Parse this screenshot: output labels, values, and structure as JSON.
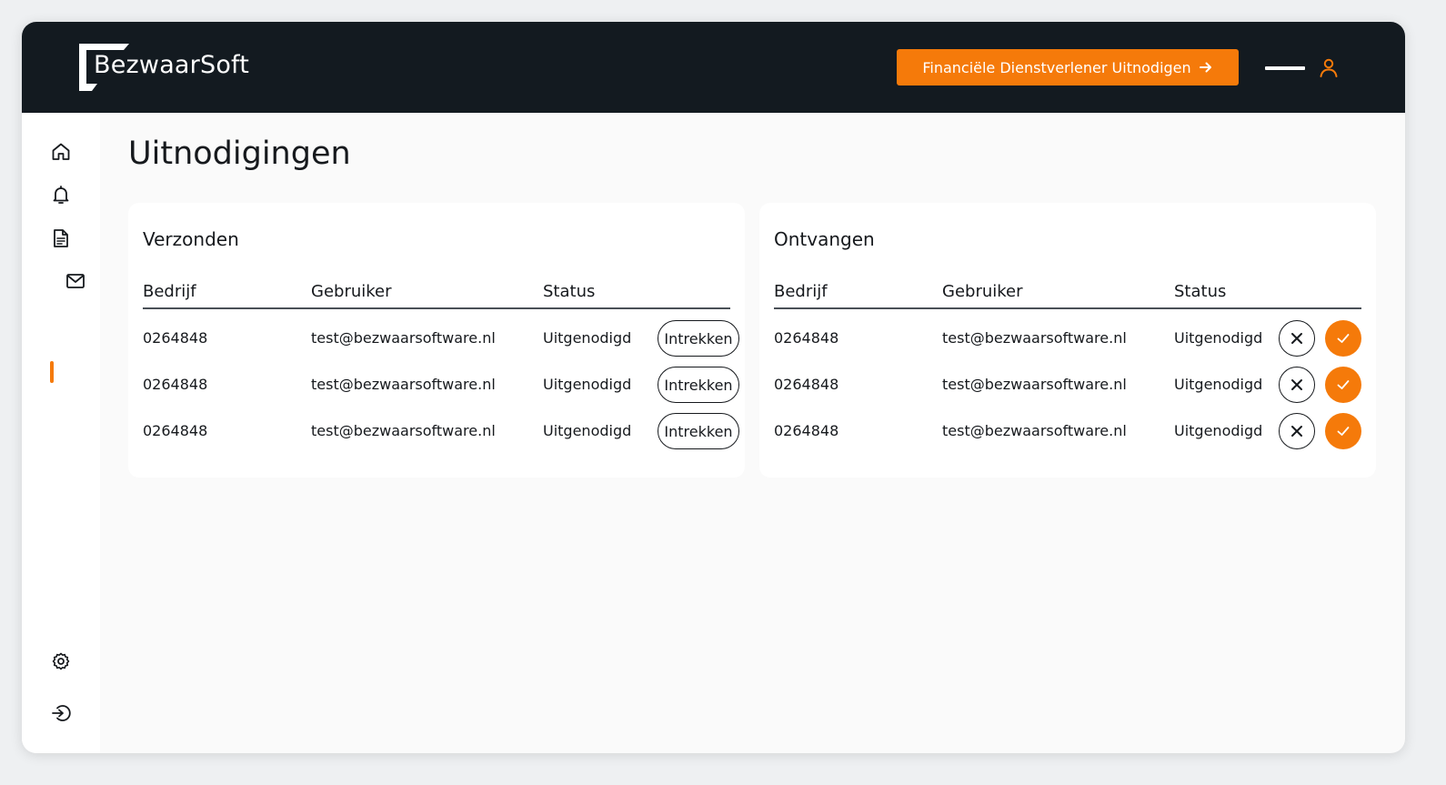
{
  "header": {
    "logo_text": "BezwaarSoft",
    "invite_button_label": "Financiële Dienstverlener Uitnodigen",
    "invite_button_icon": "arrow-right-icon",
    "user_icon": "user-icon",
    "menu_icon": "menu-bar-icon"
  },
  "sidebar": {
    "items": [
      {
        "icon": "home-icon",
        "active": false
      },
      {
        "icon": "bell-icon",
        "active": false
      },
      {
        "icon": "document-icon",
        "active": false
      },
      {
        "icon": "mail-icon",
        "active": true
      }
    ],
    "bottom_items": [
      {
        "icon": "gear-icon"
      },
      {
        "icon": "logout-icon"
      }
    ]
  },
  "page": {
    "title": "Uitnodigingen"
  },
  "sent": {
    "title": "Verzonden",
    "columns": [
      "Bedrijf",
      "Gebruiker",
      "Status"
    ],
    "rows": [
      {
        "company": "0264848",
        "user": "test@bezwaarsoftware.nl",
        "status": "Uitgenodigd",
        "action": "Intrekken"
      },
      {
        "company": "0264848",
        "user": "test@bezwaarsoftware.nl",
        "status": "Uitgenodigd",
        "action": "Intrekken"
      },
      {
        "company": "0264848",
        "user": "test@bezwaarsoftware.nl",
        "status": "Uitgenodigd",
        "action": "Intrekken"
      }
    ]
  },
  "received": {
    "title": "Ontvangen",
    "columns": [
      "Bedrijf",
      "Gebruiker",
      "Status"
    ],
    "rows": [
      {
        "company": "0264848",
        "user": "test@bezwaarsoftware.nl",
        "status": "Uitgenodigd",
        "reject_icon": "close-icon",
        "accept_icon": "check-icon"
      },
      {
        "company": "0264848",
        "user": "test@bezwaarsoftware.nl",
        "status": "Uitgenodigd",
        "reject_icon": "close-icon",
        "accept_icon": "check-icon"
      },
      {
        "company": "0264848",
        "user": "test@bezwaarsoftware.nl",
        "status": "Uitgenodigd",
        "reject_icon": "close-icon",
        "accept_icon": "check-icon"
      }
    ]
  },
  "colors": {
    "accent": "#f57a0a",
    "header_bg": "#131a20",
    "text": "#16191d"
  }
}
